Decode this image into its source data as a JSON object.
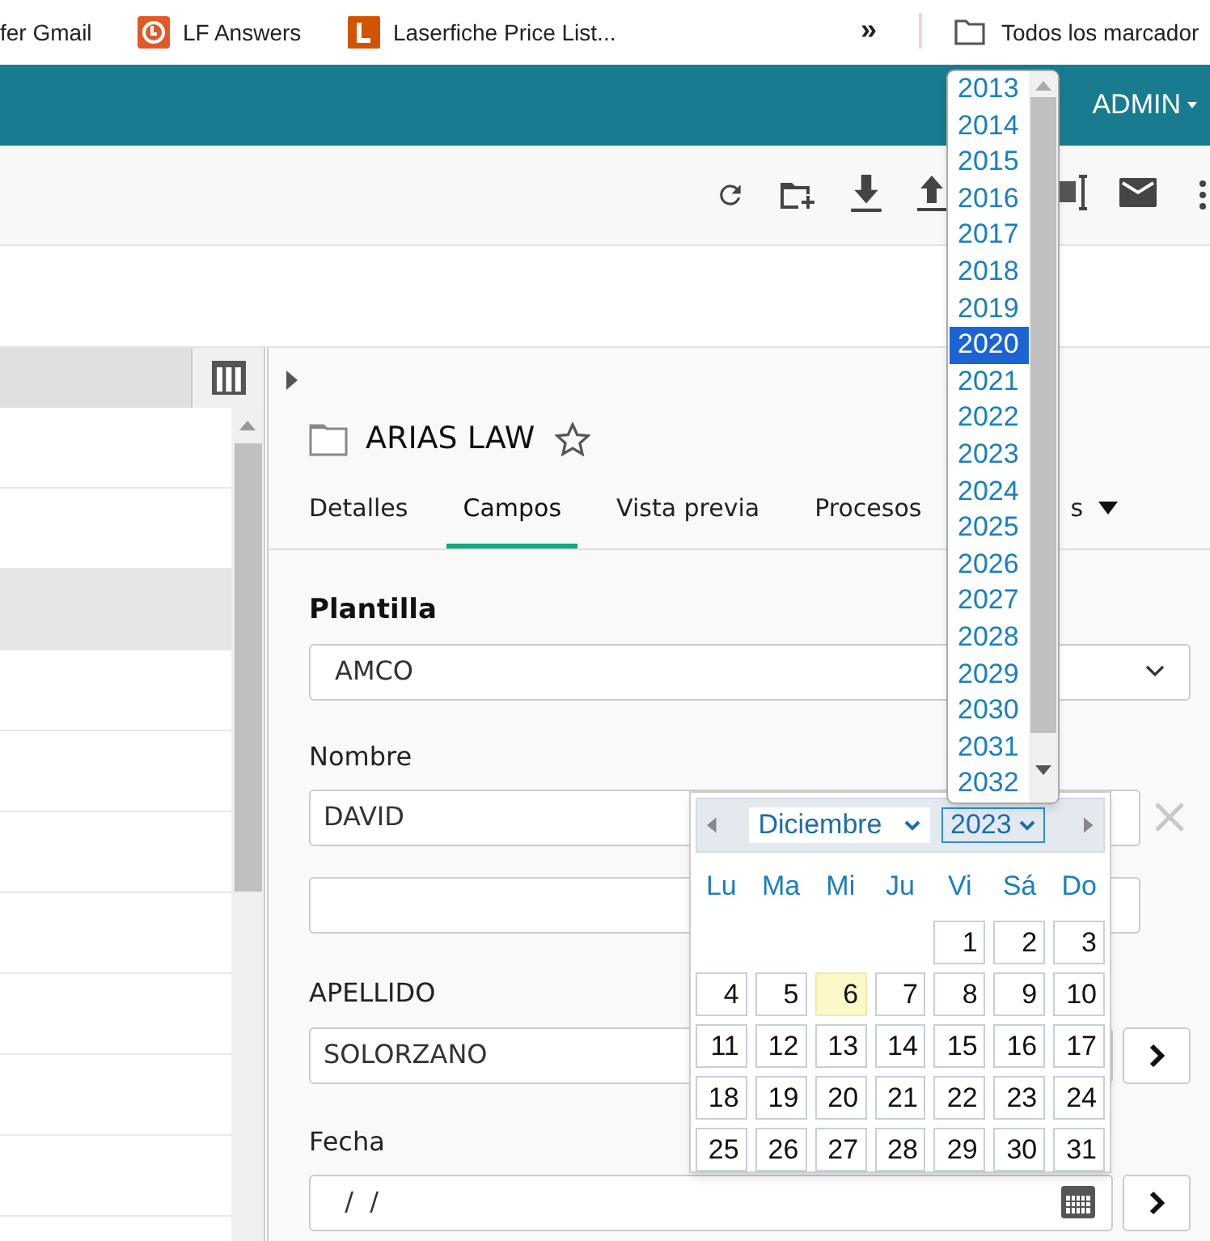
{
  "bookmarks": [
    {
      "label": "fer Gmail",
      "kind": "plain"
    },
    {
      "label": "LF Answers",
      "kind": "lf-circle"
    },
    {
      "label": "Laserfiche Price List...",
      "kind": "lf-square"
    }
  ],
  "bookmarks_more": "»",
  "all_bookmarks": "Todos los marcador",
  "header": {
    "user": "ADMIN"
  },
  "list_rows": [
    {
      "selected": false
    },
    {
      "selected": false
    },
    {
      "selected": true
    },
    {
      "selected": false
    },
    {
      "selected": false
    },
    {
      "selected": false
    },
    {
      "selected": false
    },
    {
      "selected": false
    },
    {
      "selected": false
    },
    {
      "selected": false
    }
  ],
  "details": {
    "title": "ARIAS LAW",
    "favorite": false,
    "tabs": [
      {
        "label": "Detalles",
        "selected": false
      },
      {
        "label": "Campos",
        "selected": true
      },
      {
        "label": "Vista previa",
        "selected": false
      },
      {
        "label": "Procesos",
        "tail": "s",
        "selected": false,
        "kind": "menu"
      }
    ],
    "fields": [
      {
        "label": "Plantilla",
        "kind": "select",
        "value": "AMCO"
      },
      {
        "label": "Nombre",
        "kind": "multi",
        "values": [
          "DAVID"
        ]
      },
      {
        "label": "APELLIDO",
        "kind": "text",
        "value": "SOLORZANO"
      },
      {
        "label": "Fecha",
        "kind": "date",
        "value": " /  /"
      }
    ]
  },
  "year_dropdown": [
    {
      "label": "2013",
      "selected": false
    },
    {
      "label": "2014",
      "selected": false
    },
    {
      "label": "2015",
      "selected": false
    },
    {
      "label": "2016",
      "selected": false
    },
    {
      "label": "2017",
      "selected": false
    },
    {
      "label": "2018",
      "selected": false
    },
    {
      "label": "2019",
      "selected": false
    },
    {
      "label": "2020",
      "selected": true
    },
    {
      "label": "2021",
      "selected": false
    },
    {
      "label": "2022",
      "selected": false
    },
    {
      "label": "2023",
      "selected": false
    },
    {
      "label": "2024",
      "selected": false
    },
    {
      "label": "2025",
      "selected": false
    },
    {
      "label": "2026",
      "selected": false
    },
    {
      "label": "2027",
      "selected": false
    },
    {
      "label": "2028",
      "selected": false
    },
    {
      "label": "2029",
      "selected": false
    },
    {
      "label": "2030",
      "selected": false
    },
    {
      "label": "2031",
      "selected": false
    },
    {
      "label": "2032",
      "selected": false
    }
  ],
  "calendar": {
    "month": "Diciembre",
    "year": "2023",
    "weekdays": [
      "Lu",
      "Ma",
      "Mi",
      "Ju",
      "Vi",
      "Sá",
      "Do"
    ],
    "weeks": [
      [
        {
          "kind": "blank"
        },
        {
          "kind": "blank"
        },
        {
          "kind": "blank"
        },
        {
          "kind": "blank"
        },
        {
          "label": "1",
          "today": false
        },
        {
          "label": "2",
          "today": false
        },
        {
          "label": "3",
          "today": false
        }
      ],
      [
        {
          "label": "4",
          "today": false
        },
        {
          "label": "5",
          "today": false
        },
        {
          "label": "6",
          "today": true
        },
        {
          "label": "7",
          "today": false
        },
        {
          "label": "8",
          "today": false
        },
        {
          "label": "9",
          "today": false
        },
        {
          "label": "10",
          "today": false
        }
      ],
      [
        {
          "label": "11",
          "today": false
        },
        {
          "label": "12",
          "today": false
        },
        {
          "label": "13",
          "today": false
        },
        {
          "label": "14",
          "today": false
        },
        {
          "label": "15",
          "today": false
        },
        {
          "label": "16",
          "today": false
        },
        {
          "label": "17",
          "today": false
        }
      ],
      [
        {
          "label": "18",
          "today": false
        },
        {
          "label": "19",
          "today": false
        },
        {
          "label": "20",
          "today": false
        },
        {
          "label": "21",
          "today": false
        },
        {
          "label": "22",
          "today": false
        },
        {
          "label": "23",
          "today": false
        },
        {
          "label": "24",
          "today": false
        }
      ],
      [
        {
          "label": "25",
          "today": false
        },
        {
          "label": "26",
          "today": false
        },
        {
          "label": "27",
          "today": false
        },
        {
          "label": "28",
          "today": false
        },
        {
          "label": "29",
          "today": false
        },
        {
          "label": "30",
          "today": false
        },
        {
          "label": "31",
          "today": false
        }
      ]
    ]
  }
}
